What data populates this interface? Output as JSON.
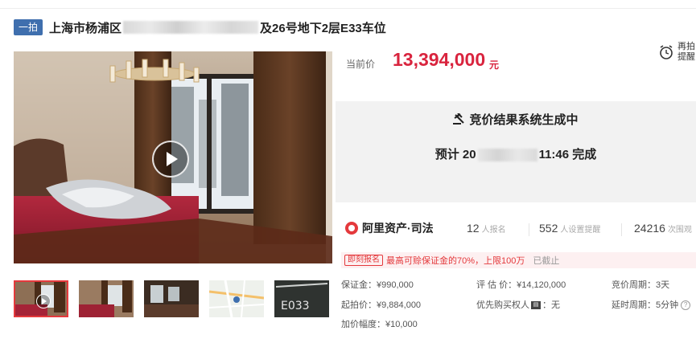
{
  "title": {
    "badge": "一拍",
    "prefix": "上海市杨浦区",
    "suffix": "及26号地下2层E33车位"
  },
  "price": {
    "label": "当前价",
    "value": "13,394,000",
    "unit": "元"
  },
  "remind": {
    "line1": "再拍",
    "line2": "提醒"
  },
  "status": {
    "heading": "竞价结果系统生成中",
    "expect_prefix": "预计 20",
    "expect_suffix": "11:46 完成"
  },
  "brand": {
    "name": "阿里资产·司法"
  },
  "stats": [
    {
      "value": "12",
      "label": "人报名"
    },
    {
      "value": "552",
      "label": "人设置提醒"
    },
    {
      "value": "24216",
      "label": "次围观"
    }
  ],
  "notice": {
    "tag": "即刻报名",
    "text": "最高可赊保证金的70%，上限100万",
    "end": "已截止"
  },
  "info": {
    "deposit": "保证金：¥990,000",
    "appraisal": "评 估 价：¥14,120,000",
    "cycle": "竞价周期：3天",
    "start_price": "起拍价：¥9,884,000",
    "priority": "优先购买权人",
    "priority_value": "：无",
    "delay": "延时周期：5分钟",
    "increment": "加价幅度：¥10,000"
  },
  "colors": {
    "accent": "#d9243e",
    "badge": "#3f6fae",
    "panel": "#f2f2f2"
  },
  "icons": [
    "alarm-clock-icon",
    "gavel-icon",
    "play-icon",
    "brand-logo-icon",
    "question-icon"
  ]
}
